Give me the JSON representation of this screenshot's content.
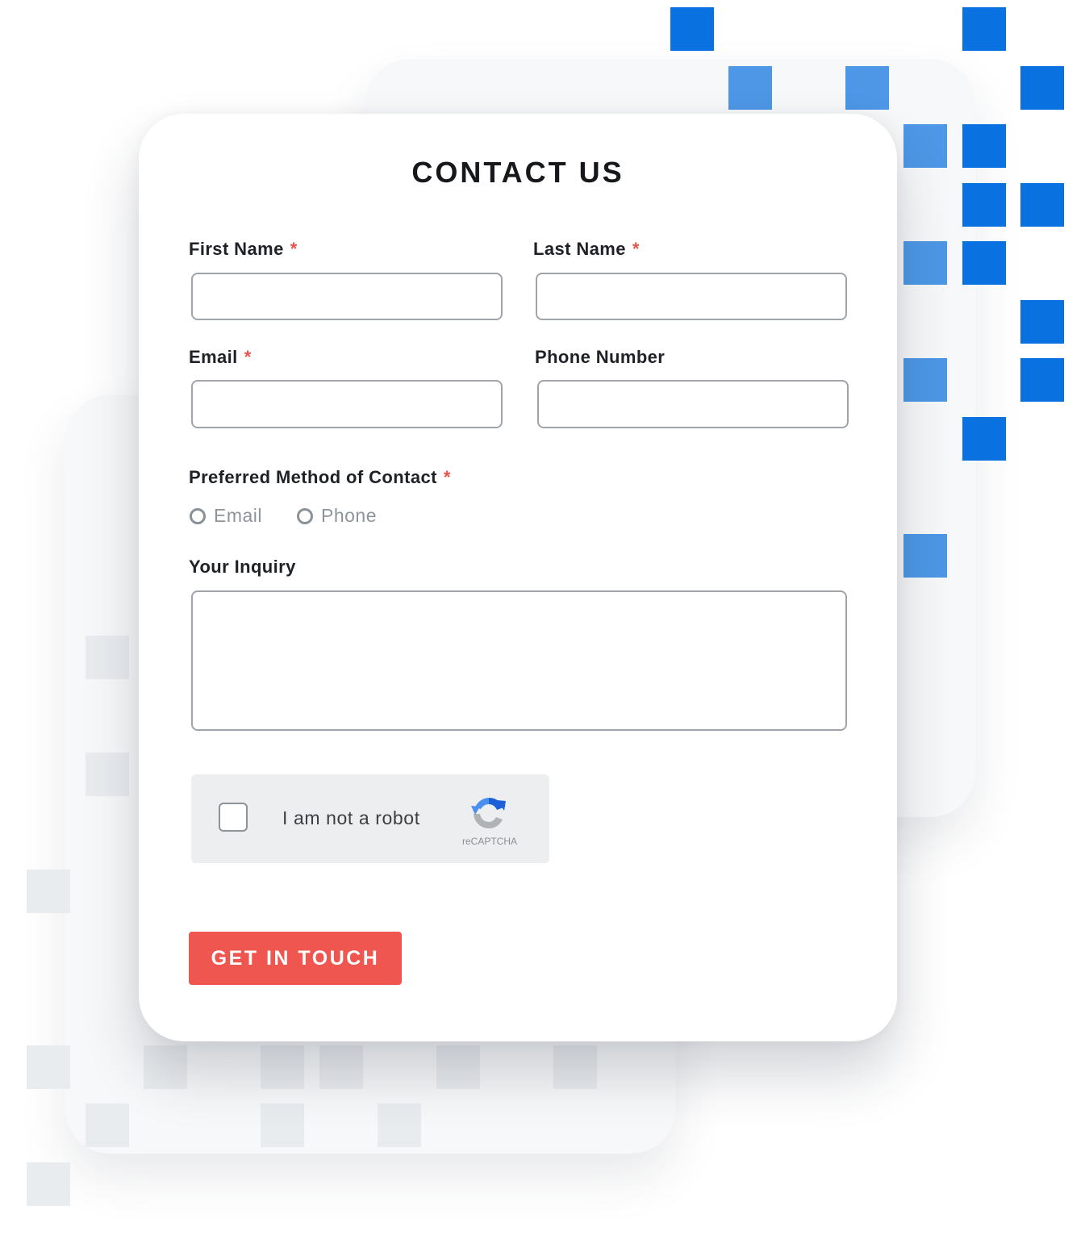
{
  "form": {
    "title": "CONTACT US",
    "first_name": {
      "label": "First Name",
      "required_mark": "*",
      "value": ""
    },
    "last_name": {
      "label": "Last Name",
      "required_mark": "*",
      "value": ""
    },
    "email": {
      "label": "Email",
      "required_mark": "*",
      "value": ""
    },
    "phone": {
      "label": "Phone Number",
      "value": ""
    },
    "preferred_contact": {
      "label": "Preferred Method of Contact",
      "required_mark": "*",
      "options": [
        "Email",
        "Phone"
      ],
      "selected": null
    },
    "inquiry": {
      "label": "Your Inquiry",
      "value": ""
    },
    "captcha": {
      "label": "I am not a robot",
      "brand": "reCAPTCHA",
      "checked": false
    },
    "submit_label": "GET IN TOUCH"
  },
  "colors": {
    "accent": "#ee564f",
    "required": "#e8524a",
    "decor_blue": "#0a72e0",
    "decor_light_blue": "#4d97e6",
    "decor_gray": "#e9ecef"
  }
}
